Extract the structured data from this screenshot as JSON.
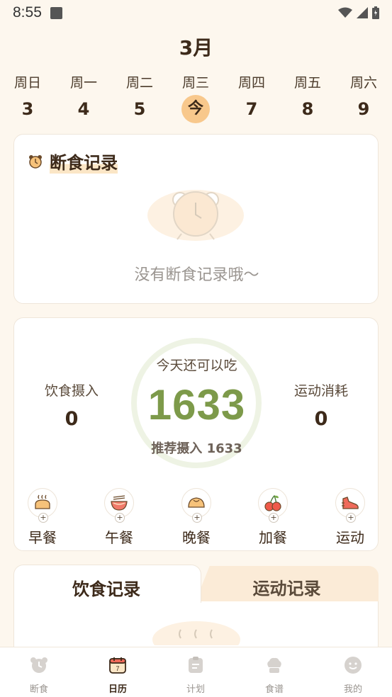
{
  "status": {
    "time": "8:55"
  },
  "calendar": {
    "month": "3月",
    "days": [
      {
        "name": "周日",
        "num": "3"
      },
      {
        "name": "周一",
        "num": "4"
      },
      {
        "name": "周二",
        "num": "5"
      },
      {
        "name": "周三",
        "num": "今"
      },
      {
        "name": "周四",
        "num": "7"
      },
      {
        "name": "周五",
        "num": "8"
      },
      {
        "name": "周六",
        "num": "9"
      }
    ]
  },
  "fasting": {
    "title": "断食记录",
    "empty_text": "没有断食记录哦～"
  },
  "calories": {
    "remain_label": "今天还可以吃",
    "remain_value": "1633",
    "recommend": "推荐摄入 1633",
    "intake_label": "饮食摄入",
    "intake_value": "0",
    "burn_label": "运动消耗",
    "burn_value": "0",
    "progress_fraction": 0.0
  },
  "meals": [
    {
      "label": "早餐",
      "icon": "bread-icon"
    },
    {
      "label": "午餐",
      "icon": "noodle-bowl-icon"
    },
    {
      "label": "晚餐",
      "icon": "bun-icon"
    },
    {
      "label": "加餐",
      "icon": "cherry-icon"
    },
    {
      "label": "运动",
      "icon": "sneaker-icon"
    }
  ],
  "tabs": {
    "diet": "饮食记录",
    "sport": "运动记录"
  },
  "nav": [
    {
      "label": "断食",
      "icon": "alarm-clock-icon"
    },
    {
      "label": "日历",
      "icon": "calendar-icon"
    },
    {
      "label": "计划",
      "icon": "clipboard-icon"
    },
    {
      "label": "食谱",
      "icon": "chef-hat-icon"
    },
    {
      "label": "我的",
      "icon": "smiley-icon"
    }
  ],
  "colors": {
    "background": "#fdf7ee",
    "accent_today": "#f8c88c",
    "calorie_green": "#7d9a4a",
    "ring": "#eef3e4"
  }
}
